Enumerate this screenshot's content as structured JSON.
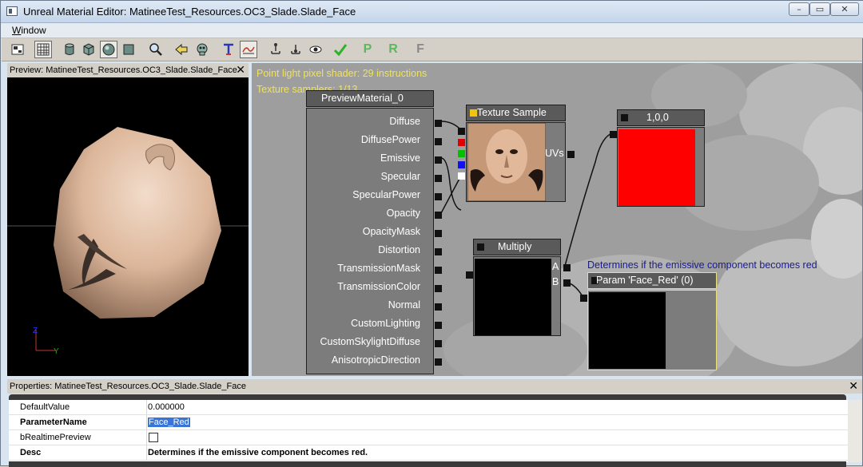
{
  "window": {
    "title": "Unreal Material Editor: MatineeTest_Resources.OC3_Slade.Slade_Face",
    "minimize": "–",
    "maximize": "▭",
    "close": "✕"
  },
  "menu": {
    "window_label": "Window",
    "window_accel": "W",
    "window_rest": "indow"
  },
  "toolbar": {
    "icons": [
      "home-icon",
      "grid-icon",
      "cylinder-icon",
      "cube-icon",
      "sphere-icon",
      "plane-icon",
      "search-icon",
      "back-arrow-icon",
      "skull-icon",
      "text-icon",
      "curve-icon",
      "node-up-icon",
      "node-down-icon",
      "eye-icon",
      "apply-check-icon"
    ],
    "letters": [
      "P",
      "R",
      "F"
    ],
    "colors": {
      "check": "#28b428",
      "green_letters": "#5cb85c",
      "gray_letter": "#8a8a8a"
    }
  },
  "preview": {
    "title": "Preview: MatineeTest_Resources.OC3_Slade.Slade_Face",
    "close": "✕",
    "axis_z": "Z",
    "axis_y": "Y"
  },
  "stats": {
    "line1": "Point light pixel shader: 29 instructions",
    "line2": "Texture samplers: 1/13"
  },
  "nodes": {
    "material": {
      "title": "PreviewMaterial_0",
      "inputs": [
        "Diffuse",
        "DiffusePower",
        "Emissive",
        "Specular",
        "SpecularPower",
        "Opacity",
        "OpacityMask",
        "Distortion",
        "TransmissionMask",
        "TransmissionColor",
        "Normal",
        "CustomLighting",
        "CustomSkylightDiffuse",
        "AnisotropicDirection"
      ]
    },
    "texture_sample": {
      "title": "Texture Sample",
      "output": "UVs",
      "channel_colors": [
        "#e00000",
        "#00c000",
        "#1010f0",
        "#ffffff"
      ]
    },
    "constant": {
      "title": "1,0,0",
      "color": "#ff0000"
    },
    "multiply": {
      "title": "Multiply",
      "inputs": [
        "A",
        "B"
      ]
    },
    "param": {
      "title": "Param 'Face_Red' (0)",
      "comment": "Determines if the emissive component becomes red"
    }
  },
  "properties": {
    "title": "Properties: MatineeTest_Resources.OC3_Slade.Slade_Face",
    "close": "✕",
    "rows": [
      {
        "name": "DefaultValue",
        "value": "0.000000"
      },
      {
        "name": "ParameterName",
        "value": "Face_Red"
      },
      {
        "name": "bRealtimePreview",
        "value": ""
      },
      {
        "name": "Desc",
        "value": "Determines if the emissive component becomes red."
      }
    ]
  }
}
